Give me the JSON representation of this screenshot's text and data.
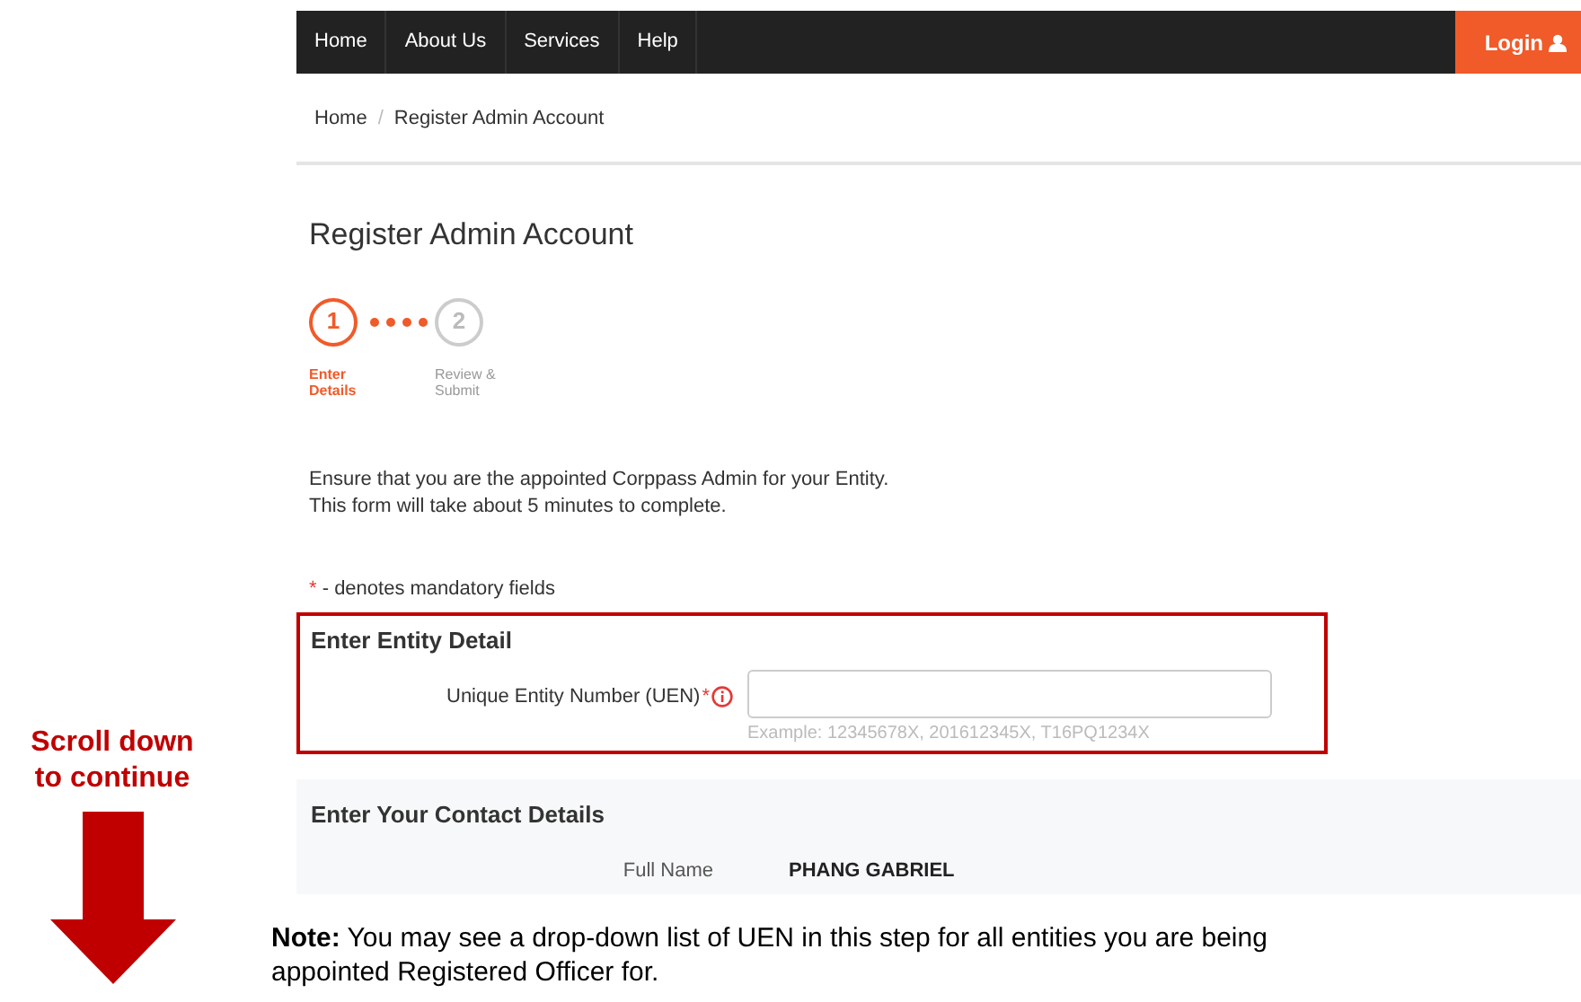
{
  "nav": {
    "items": [
      {
        "label": "Home"
      },
      {
        "label": "About Us"
      },
      {
        "label": "Services"
      },
      {
        "label": "Help"
      }
    ],
    "login": {
      "label": "Login"
    }
  },
  "breadcrumb": [
    "Home",
    "Register Admin Account"
  ],
  "breadcrumb_separator": "/",
  "title": "Register Admin Account",
  "steps": [
    {
      "number": "1",
      "label": "Enter Details",
      "selected": true
    },
    {
      "number": "2",
      "label": "Review & Submit",
      "selected": false
    }
  ],
  "intro": [
    "Ensure that you are the appointed Corppass Admin for your Entity.",
    "This form will take about 5 minutes to complete."
  ],
  "mandatory_note": {
    "mark": "*",
    "text": "- denotes mandatory fields"
  },
  "entity_section": {
    "heading": "Enter Entity Detail",
    "highlighted": true,
    "field": {
      "label": "Unique Entity Number (UEN)",
      "required": true,
      "hint": "Example: 12345678X, 201612345X, T16PQ1234X"
    }
  },
  "contact_section": {
    "heading": "Enter Your Contact Details",
    "rows": [
      {
        "label": "Full Name",
        "value": "PHANG GABRIEL"
      }
    ]
  },
  "annotation": {
    "lines": [
      "Scroll down",
      "to continue"
    ]
  },
  "note": "**Note:** You may see a drop-down list of UEN in this step for all entities you are being appointed Registered Officer for."
}
